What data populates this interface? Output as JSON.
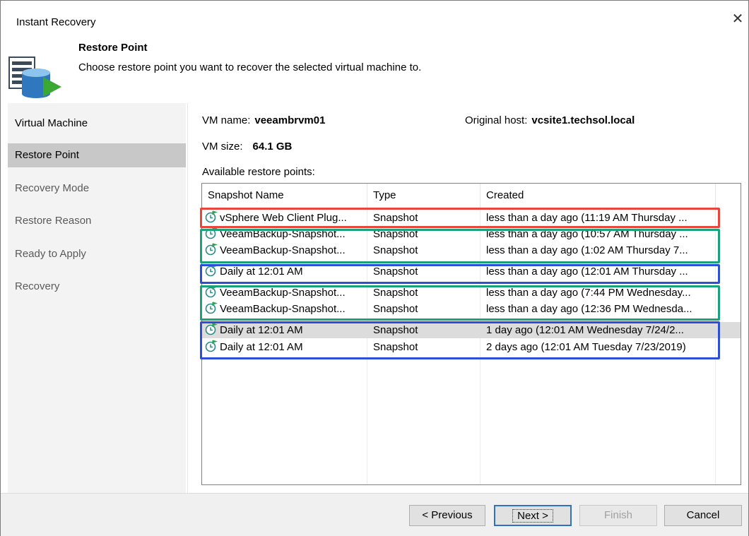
{
  "window": {
    "title": "Instant Recovery",
    "close_glyph": "✕"
  },
  "header": {
    "title": "Restore Point",
    "subtitle": "Choose restore point you want to recover the selected virtual machine to.",
    "icon": "database-restore-icon"
  },
  "sidebar": {
    "items": [
      {
        "label": "Virtual Machine",
        "state": "done"
      },
      {
        "label": "Restore Point",
        "state": "active"
      },
      {
        "label": "Recovery Mode",
        "state": "pending"
      },
      {
        "label": "Restore Reason",
        "state": "pending"
      },
      {
        "label": "Ready to Apply",
        "state": "pending"
      },
      {
        "label": "Recovery",
        "state": "pending"
      }
    ]
  },
  "vm": {
    "name_label": "VM name:",
    "name": "veeambrvm01",
    "host_label": "Original host:",
    "host": "vcsite1.techsol.local",
    "size_label": "VM size:",
    "size": "64.1 GB"
  },
  "restore_points": {
    "label": "Available restore points:",
    "columns": [
      "Snapshot Name",
      "Type",
      "Created"
    ],
    "rows": [
      {
        "name": "vSphere Web Client Plug...",
        "type": "Snapshot",
        "created": "less than a day ago (11:19 AM Thursday ..."
      },
      {
        "name": "VeeamBackup-Snapshot...",
        "type": "Snapshot",
        "created": "less than a day ago (10:57 AM Thursday ..."
      },
      {
        "name": "VeeamBackup-Snapshot...",
        "type": "Snapshot",
        "created": "less than a day ago (1:02 AM Thursday 7..."
      },
      {
        "name": "Daily at 12:01 AM",
        "type": "Snapshot",
        "created": "less than a day ago (12:01 AM Thursday ..."
      },
      {
        "name": "VeeamBackup-Snapshot...",
        "type": "Snapshot",
        "created": "less than a day ago (7:44 PM Wednesday..."
      },
      {
        "name": "VeeamBackup-Snapshot...",
        "type": "Snapshot",
        "created": "less than a day ago (12:36 PM Wednesda..."
      },
      {
        "name": "Daily at 12:01 AM",
        "type": "Snapshot",
        "created": "1 day ago (12:01 AM Wednesday 7/24/2..."
      },
      {
        "name": "Daily at 12:01 AM",
        "type": "Snapshot",
        "created": "2 days ago (12:01 AM Tuesday 7/23/2019)"
      }
    ],
    "selected_row": 6
  },
  "highlights": {
    "red": "#e8453c",
    "green": "#1aa37a",
    "blue": "#2d4fd6"
  },
  "footer": {
    "previous": "< Previous",
    "next": "Next >",
    "finish": "Finish",
    "cancel": "Cancel"
  }
}
